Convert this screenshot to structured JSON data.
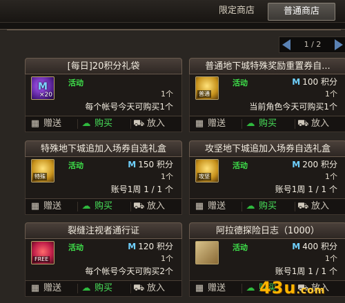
{
  "tabs": {
    "limited": "限定商店",
    "normal": "普通商店"
  },
  "pager": {
    "text": "1 / 2"
  },
  "cards": [
    {
      "title": "[每日]20积分礼袋",
      "tag": "活动",
      "icon": "purple-m-bag-icon",
      "icon_count": "×20",
      "price_amount": "",
      "quantity": "1个",
      "limit": "每个帐号今天可购买1个",
      "buttons": {
        "gift": "赠送",
        "buy": "购买",
        "cart": "放入"
      }
    },
    {
      "title": "普通地下城特殊奖励重置券自...",
      "tag": "活动",
      "icon": "gold-ticket-icon",
      "icon_badge": "普通",
      "price_symbol": "M",
      "price_amount": "100",
      "price_unit": "积分",
      "quantity": "1个",
      "limit": "当前角色今天可购买1个",
      "buttons": {
        "gift": "赠送",
        "buy": "购买",
        "cart": "放入"
      }
    },
    {
      "title": "特殊地下城追加入场券自选礼盒",
      "tag": "活动",
      "icon": "gold-ticket-icon",
      "icon_badge": "特殊",
      "price_symbol": "M",
      "price_amount": "150",
      "price_unit": "积分",
      "quantity": "1个",
      "limit": "账号1周 1 / 1 个",
      "buttons": {
        "gift": "赠送",
        "buy": "购买",
        "cart": "放入"
      }
    },
    {
      "title": "攻坚地下城追加入场券自选礼盒",
      "tag": "活动",
      "icon": "gold-ticket-icon",
      "icon_badge": "攻坚",
      "price_symbol": "M",
      "price_amount": "200",
      "price_unit": "积分",
      "quantity": "1个",
      "limit": "账号1周 1 / 1 个",
      "buttons": {
        "gift": "赠送",
        "buy": "购买",
        "cart": "放入"
      }
    },
    {
      "title": "裂缝注视者通行证",
      "tag": "活动",
      "icon": "red-gear-pass-icon",
      "icon_badge": "FREE",
      "price_symbol": "M",
      "price_amount": "120",
      "price_unit": "积分",
      "quantity": "1个",
      "limit": "每个帐号今天可购买2个",
      "buttons": {
        "gift": "赠送",
        "buy": "购买",
        "cart": "放入"
      }
    },
    {
      "title": "阿拉德探险日志（1000）",
      "tag": "活动",
      "icon": "scroll-book-icon",
      "price_symbol": "M",
      "price_amount": "400",
      "price_unit": "积分",
      "quantity": "1个",
      "limit": "账号1周 1 / 1 个",
      "buttons": {
        "gift": "赠送",
        "buy": "购买",
        "cart": "放入"
      }
    }
  ],
  "watermark": {
    "main": "43u",
    "suffix": ".com"
  },
  "colors": {
    "tag_green": "#3ee04a",
    "m_blue": "#6fd1ff",
    "buy_green": "#48e05a",
    "logo_orange": "#ffb400"
  }
}
